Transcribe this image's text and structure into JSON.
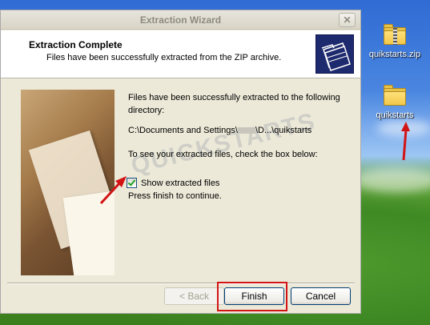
{
  "window": {
    "title": "Extraction Wizard",
    "close_glyph": "✕"
  },
  "header": {
    "title": "Extraction Complete",
    "subtitle": "Files have been successfully extracted from the ZIP archive.",
    "icon": "folder-stack-icon"
  },
  "body": {
    "line1": "Files have been successfully extracted to the following",
    "line2": "directory:",
    "path_prefix": "C:\\Documents and Settings\\",
    "path_suffix": "\\D...\\quikstarts",
    "instruction": "To see your extracted files, check the box below:",
    "checkbox_label": "Show extracted files",
    "checkbox_checked": true,
    "finish_note": "Press finish to continue."
  },
  "buttons": {
    "back": "< Back",
    "finish": "Finish",
    "cancel": "Cancel"
  },
  "desktop": {
    "icons": [
      {
        "label": "quikstarts.zip",
        "icon": "zip-folder-icon"
      },
      {
        "label": "quikstarts",
        "icon": "folder-icon"
      }
    ]
  },
  "colors": {
    "annotation_red": "#d31414",
    "header_icon_bg": "#1e2a6e"
  }
}
